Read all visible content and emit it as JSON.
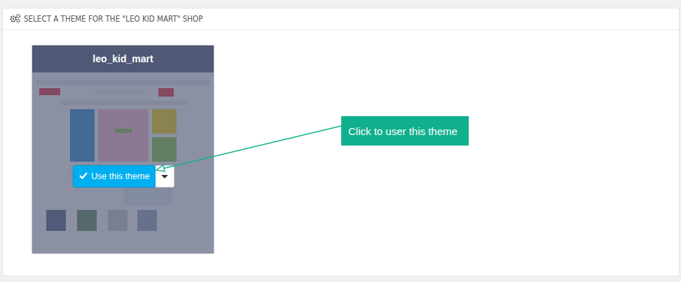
{
  "panel": {
    "title": "SELECT A THEME FOR THE \"LEO KID MART\" SHOP"
  },
  "themes": [
    {
      "name": "leo_kid_mart",
      "button": "Use this theme"
    }
  ],
  "callout": {
    "text": "Click to user this theme"
  }
}
